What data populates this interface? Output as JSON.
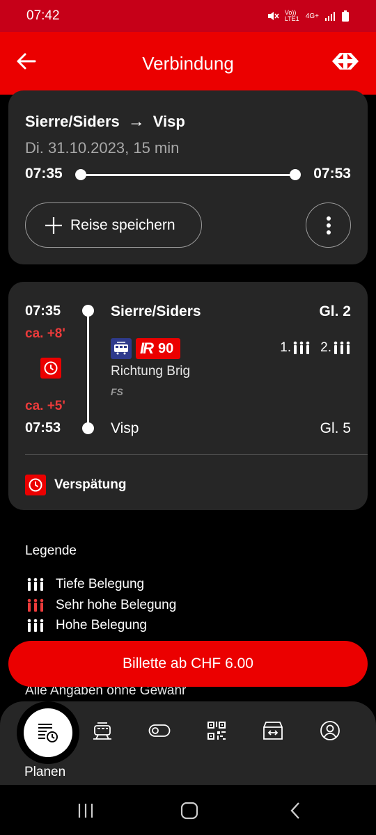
{
  "status_bar": {
    "time": "07:42",
    "network": "Vo)) LTE1",
    "signal_type": "4G+"
  },
  "app_bar": {
    "title": "Verbindung"
  },
  "summary": {
    "from": "Sierre/Siders",
    "arrow": "→",
    "to": "Visp",
    "date_duration": "Di. 31.10.2023, 15 min",
    "departure": "07:35",
    "arrival": "07:53",
    "save_label": "Reise speichern"
  },
  "leg": {
    "dep_time": "07:35",
    "dep_delay": "ca. +8'",
    "arr_delay": "ca. +5'",
    "arr_time": "07:53",
    "dep_station": "Sierre/Siders",
    "dep_platform": "Gl. 2",
    "train_type": "IR",
    "train_number": "90",
    "occupancy_first": "1.",
    "occupancy_second": "2.",
    "direction": "Richtung Brig",
    "operator": "FS",
    "arr_station": "Visp",
    "arr_platform": "Gl. 5",
    "delay_notice": "Verspätung"
  },
  "legend": {
    "title": "Legende",
    "items": [
      {
        "label": "Tiefe Belegung",
        "color": "#ffffff"
      },
      {
        "label": "Sehr hohe Belegung",
        "color": "#eb3b3b"
      },
      {
        "label": "Hohe Belegung",
        "color": "#ffffff"
      }
    ]
  },
  "ticket_button": "Billette ab CHF 6.00",
  "disclaimer": "Alle Angaben ohne Gewähr",
  "bottom_nav": {
    "active_label": "Planen",
    "items": [
      "timetable-icon",
      "train-icon",
      "toggle-icon",
      "qr-code-icon",
      "shop-icon",
      "profile-icon"
    ]
  },
  "colors": {
    "brand_red": "#eb0000",
    "status_red": "#c60018",
    "delay_red": "#eb3b3b",
    "card_bg": "#262626"
  }
}
